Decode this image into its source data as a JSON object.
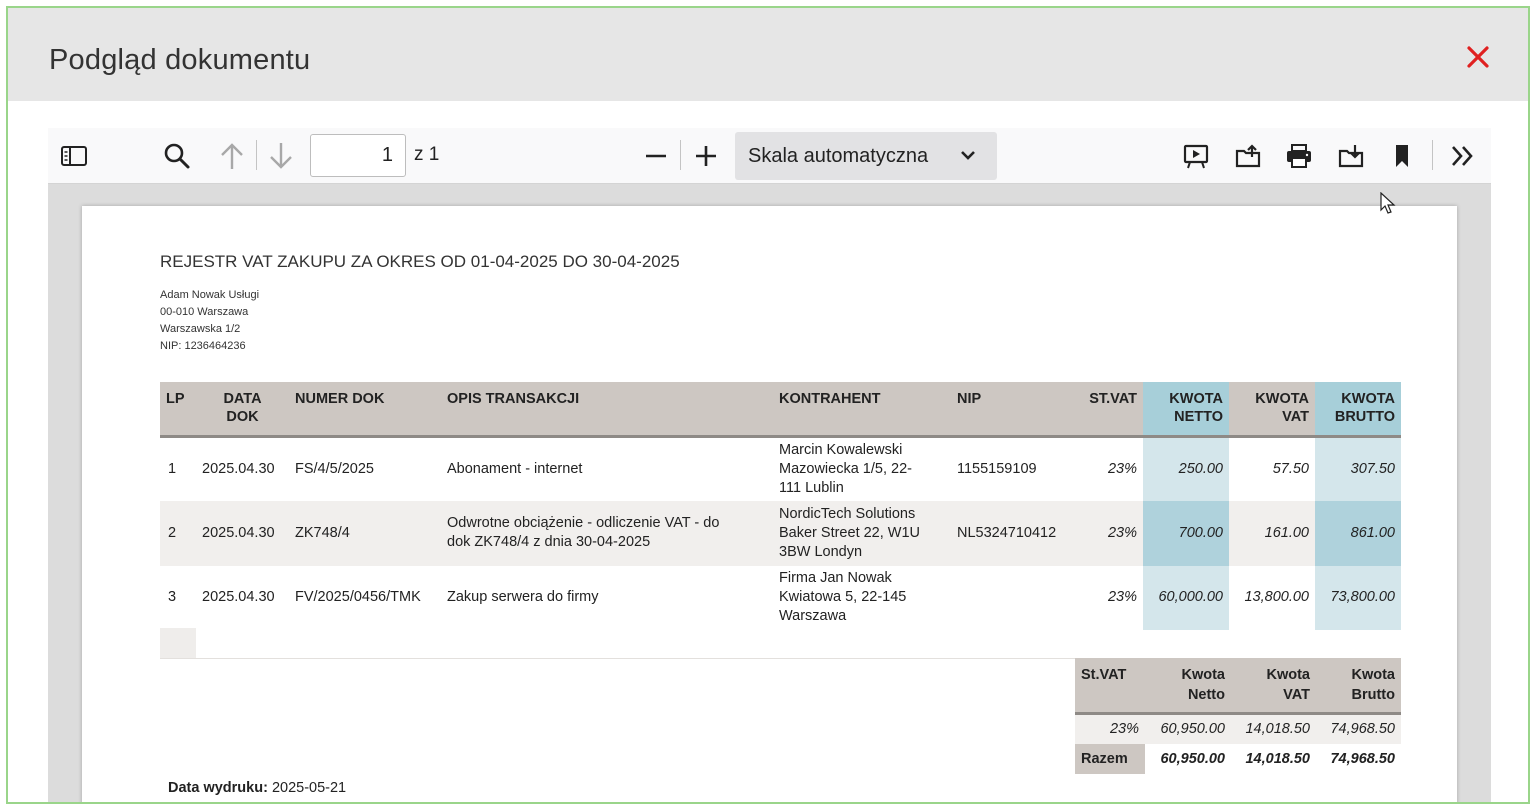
{
  "modal": {
    "title": "Podgląd dokumentu"
  },
  "toolbar": {
    "page_number": "1",
    "page_total": "z 1",
    "scale": "Skala automatyczna"
  },
  "document": {
    "title": "REJESTR VAT ZAKUPU ZA OKRES OD 01-04-2025 DO 30-04-2025",
    "company": [
      "Adam Nowak Usługi",
      "00-010 Warszawa",
      "Warszawska 1/2",
      "NIP: 1236464236"
    ],
    "columns": {
      "lp": "LP",
      "data_dok_1": "DATA",
      "data_dok_2": "DOK",
      "numer_dok": "NUMER DOK",
      "opis": "OPIS TRANSAKCJI",
      "kontrahent": "KONTRAHENT",
      "nip": "NIP",
      "st_vat": "ST.VAT",
      "netto_1": "KWOTA",
      "netto_2": "NETTO",
      "vat_1": "KWOTA",
      "vat_2": "VAT",
      "brutto_1": "KWOTA",
      "brutto_2": "BRUTTO"
    },
    "rows": [
      {
        "lp": "1",
        "data": "2025.04.30",
        "numer": "FS/4/5/2025",
        "opis": [
          "Abonament - internet"
        ],
        "kontrahent": [
          "Marcin Kowalewski",
          "Mazowiecka 1/5, 22-",
          "111 Lublin"
        ],
        "nip": "1155159109",
        "st_vat": "23%",
        "netto": "250.00",
        "vat": "57.50",
        "brutto": "307.50"
      },
      {
        "lp": "2",
        "data": "2025.04.30",
        "numer": "ZK748/4",
        "opis": [
          "Odwrotne obciążenie - odliczenie VAT - do",
          "dok ZK748/4 z dnia 30-04-2025"
        ],
        "kontrahent": [
          "NordicTech Solutions",
          "Baker Street 22, W1U",
          "3BW Londyn"
        ],
        "nip": "NL5324710412",
        "st_vat": "23%",
        "netto": "700.00",
        "vat": "161.00",
        "brutto": "861.00"
      },
      {
        "lp": "3",
        "data": "2025.04.30",
        "numer": "FV/2025/0456/TMK",
        "opis": [
          "Zakup serwera do firmy"
        ],
        "kontrahent": [
          "Firma Jan Nowak",
          "Kwiatowa 5, 22-145",
          "Warszawa"
        ],
        "nip": "",
        "st_vat": "23%",
        "netto": "60,000.00",
        "vat": "13,800.00",
        "brutto": "73,800.00"
      }
    ],
    "summary": {
      "headers": {
        "st_vat": "St.VAT",
        "netto_1": "Kwota",
        "netto_2": "Netto",
        "vat_1": "Kwota",
        "vat_2": "VAT",
        "brutto_1": "Kwota",
        "brutto_2": "Brutto"
      },
      "vat_row": {
        "st_vat": "23%",
        "netto": "60,950.00",
        "vat": "14,018.50",
        "brutto": "74,968.50"
      },
      "total_row": {
        "label": "Razem",
        "netto": "60,950.00",
        "vat": "14,018.50",
        "brutto": "74,968.50"
      }
    },
    "print_date_label": "Data wydruku:",
    "print_date": "2025-05-21"
  },
  "colors": {
    "header_bg": "#e6e6e6",
    "close_icon": "#e02020",
    "frame_border": "#9ad58a",
    "table_header": "#cdc7c2",
    "teal_header": "#a7cfd9",
    "teal_cell": "#d4e6eb"
  }
}
